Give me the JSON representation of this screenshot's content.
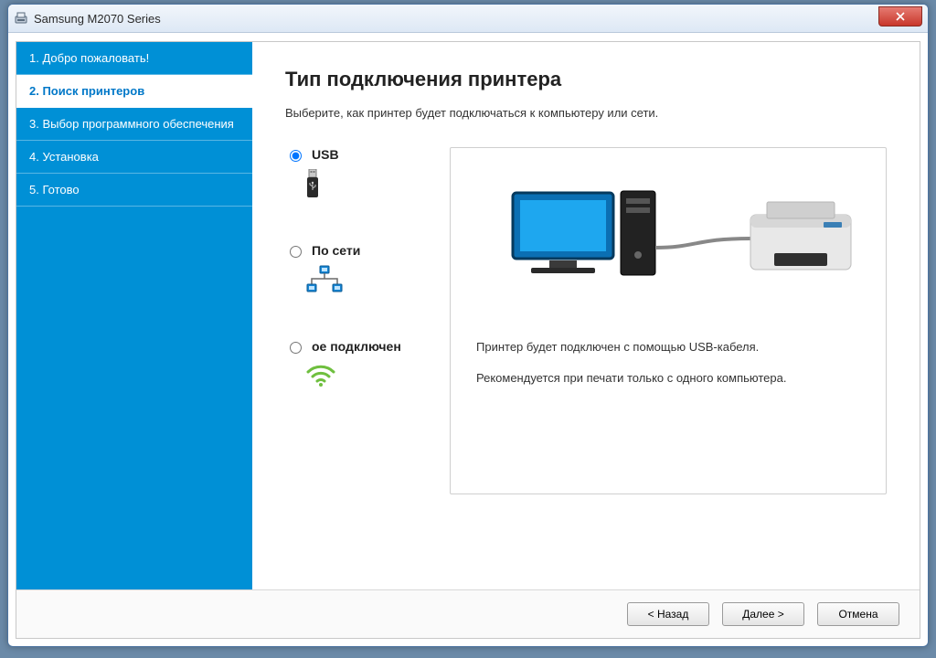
{
  "window": {
    "title": "Samsung M2070 Series"
  },
  "sidebar": {
    "steps": [
      {
        "label": "1. Добро пожаловать!"
      },
      {
        "label": "2. Поиск принтеров"
      },
      {
        "label": "3. Выбор программного обеспечения"
      },
      {
        "label": "4. Установка"
      },
      {
        "label": "5. Готово"
      }
    ],
    "active_index": 1
  },
  "main": {
    "heading": "Тип подключения принтера",
    "subtitle": "Выберите, как принтер будет подключаться к компьютеру или сети.",
    "options": [
      {
        "id": "usb",
        "label": "USB",
        "selected": true
      },
      {
        "id": "network",
        "label": "По сети",
        "selected": false
      },
      {
        "id": "wireless",
        "label": "ое подключен",
        "selected": false
      }
    ],
    "panel": {
      "line1": "Принтер будет подключен с помощью USB-кабеля.",
      "line2": "Рекомендуется при печати только с одного компьютера."
    }
  },
  "footer": {
    "back": "< Назад",
    "next": "Далее >",
    "cancel": "Отмена"
  }
}
